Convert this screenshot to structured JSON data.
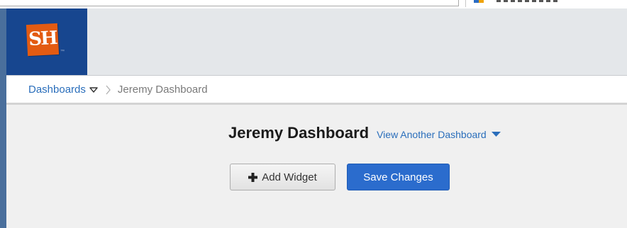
{
  "colors": {
    "brand_navy": "#17468f",
    "logo_orange": "#e35b12",
    "link_blue": "#2a6ebb",
    "primary_button": "#2b6ccd",
    "left_accent": "#4a6f9c"
  },
  "header": {
    "logo_text": "SH",
    "logo_trademark": "™",
    "logo_icon": "university-logo-icon"
  },
  "breadcrumb": {
    "dashboards_label": "Dashboards",
    "dashboards_icon": "caret-down-outline-icon",
    "separator_icon": "chevron-right-icon",
    "current_label": "Jeremy Dashboard"
  },
  "main": {
    "title": "Jeremy Dashboard",
    "view_another_label": "View Another Dashboard",
    "view_another_icon": "caret-down-icon",
    "add_widget_label": "Add Widget",
    "add_widget_icon": "plus-icon",
    "save_changes_label": "Save Changes"
  }
}
